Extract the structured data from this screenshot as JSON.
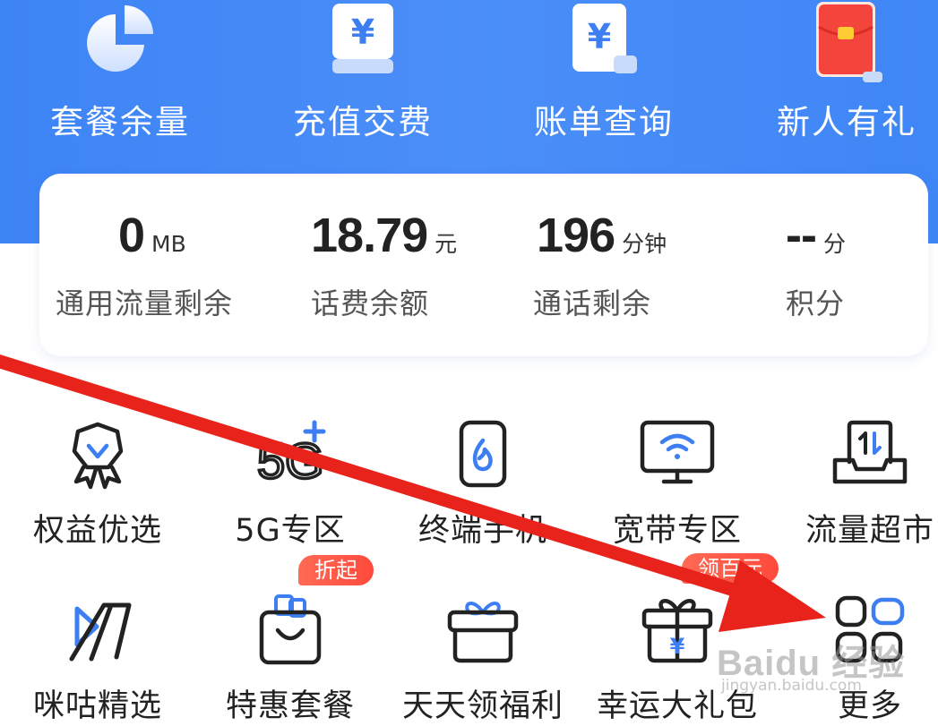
{
  "top_nav": [
    {
      "label": "套餐余量",
      "icon": "pie-chart-icon"
    },
    {
      "label": "充值交费",
      "icon": "yuan-card-icon"
    },
    {
      "label": "账单查询",
      "icon": "bill-icon"
    },
    {
      "label": "新人有礼",
      "icon": "red-envelope-icon"
    }
  ],
  "yuan_symbol": "¥",
  "stats": [
    {
      "value": "0",
      "unit": "MB",
      "caption": "通用流量剩余"
    },
    {
      "value": "18.79",
      "unit": "元",
      "caption": "话费余额"
    },
    {
      "value": "196",
      "unit": "分钟",
      "caption": "通话剩余"
    },
    {
      "value": "--",
      "unit": "分",
      "caption": "积分"
    }
  ],
  "services_row1": [
    {
      "label": "权益优选",
      "icon": "badge-ribbon-icon"
    },
    {
      "label": "5G专区",
      "icon": "5g-plus-icon",
      "icon_text": "5G"
    },
    {
      "label": "终端手机",
      "icon": "phone-icon"
    },
    {
      "label": "宽带专区",
      "icon": "monitor-wifi-icon"
    },
    {
      "label": "流量超市",
      "icon": "data-tray-icon"
    }
  ],
  "services_row2": [
    {
      "label": "咪咕精选",
      "icon": "migu-icon"
    },
    {
      "label": "特惠套餐",
      "icon": "shopping-bag-icon",
      "badge": "折起"
    },
    {
      "label": "天天领福利",
      "icon": "gift-box-icon"
    },
    {
      "label": "幸运大礼包",
      "icon": "gift-yuan-icon",
      "badge": "领百元"
    },
    {
      "label": "更多",
      "icon": "grid-more-icon"
    }
  ],
  "watermark": {
    "main": "Baidu 经验",
    "sub": "jingyan.baidu.com"
  },
  "colors": {
    "header_blue": "#4a8cf7",
    "arrow_red": "#e8231b",
    "badge_red": "#ff5544",
    "icon_accent": "#3d7ff2"
  }
}
